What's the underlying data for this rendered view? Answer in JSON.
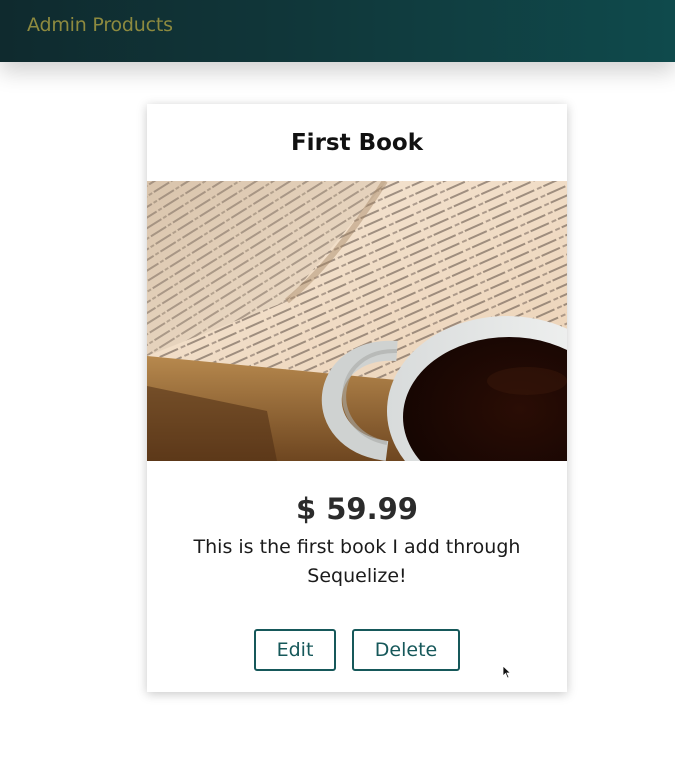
{
  "header": {
    "title": "Admin Products"
  },
  "product": {
    "title": "First Book",
    "image_description": "",
    "price": "$ 59.99",
    "description": "This is the first book I add through Sequelize!",
    "actions": {
      "edit_label": "Edit",
      "delete_label": "Delete"
    }
  },
  "colors": {
    "header_bg": "#10373a",
    "header_text": "#8d8a3f",
    "button_border": "#16585a",
    "button_text": "#16585a"
  },
  "icons": {
    "cursor": "mouse-pointer-icon"
  }
}
